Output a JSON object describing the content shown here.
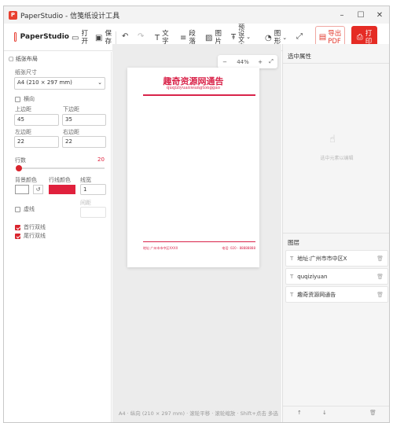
{
  "window": {
    "title": "PaperStudio - 信笺纸设计工具",
    "controls": [
      "–",
      "☐",
      "✕"
    ]
  },
  "toolbar": {
    "brand": "PaperStudio",
    "open": [
      "打",
      "开"
    ],
    "save": [
      "保",
      "存"
    ],
    "text": [
      "文",
      "字"
    ],
    "paragraph": [
      "段",
      "落"
    ],
    "image": [
      "图",
      "片"
    ],
    "preset_text": [
      "预",
      "设",
      "文",
      "本"
    ],
    "shape": [
      "图",
      "形"
    ],
    "export_pdf": [
      "导出",
      "PDF"
    ],
    "print": [
      "打",
      "印"
    ]
  },
  "left_panel": {
    "section_title": "纸张布局",
    "paper_size_label": "纸张尺寸",
    "paper_size_value": "A4 (210 × 297 mm)",
    "landscape_label": "横向",
    "landscape_checked": false,
    "margin_top_label": "上边距",
    "margin_top": "45",
    "margin_bottom_label": "下边距",
    "margin_bottom": "35",
    "margin_left_label": "左边距",
    "margin_left": "22",
    "margin_right_label": "右边距",
    "margin_right": "22",
    "rows_label": "行数",
    "rows_value": "20",
    "rows_fraction": 0.0,
    "bg_color_label": "背景颜色",
    "bg_color": "#ffffff",
    "line_color_label": "行线颜色",
    "line_color": "#e0213d",
    "line_width_label": "线宽",
    "line_width": "1",
    "dashed_label": "虚线",
    "dashed_checked": false,
    "gap_label": "间距",
    "first_double_label": "首行双线",
    "first_double_checked": true,
    "last_double_label": "尾行双线",
    "last_double_checked": true
  },
  "canvas": {
    "zoom": "44%",
    "zoom_minus": "−",
    "zoom_plus": "+",
    "paper_title": "趣奇资源网通告",
    "paper_subtitle": "quqiziyuanwangtonggao",
    "footer_address": "地址:广州市市中区XXXX",
    "footer_phone": "电话: 020 - 88888888",
    "accent": "#d9244a"
  },
  "right_panel": {
    "props_title": "选中属性",
    "empty_hint": "选中元素以编辑",
    "layers_title": "图层",
    "layers": [
      "地址:广州市市中区X",
      "quqiziyuan",
      "趣奇资源网通告"
    ]
  },
  "status": {
    "text": "A4 · 纵向 (210 × 297 mm) · 滚轮平移 · 滚轮缩放 · Shift+点击 多选 · Alt+拖拽 框选"
  }
}
